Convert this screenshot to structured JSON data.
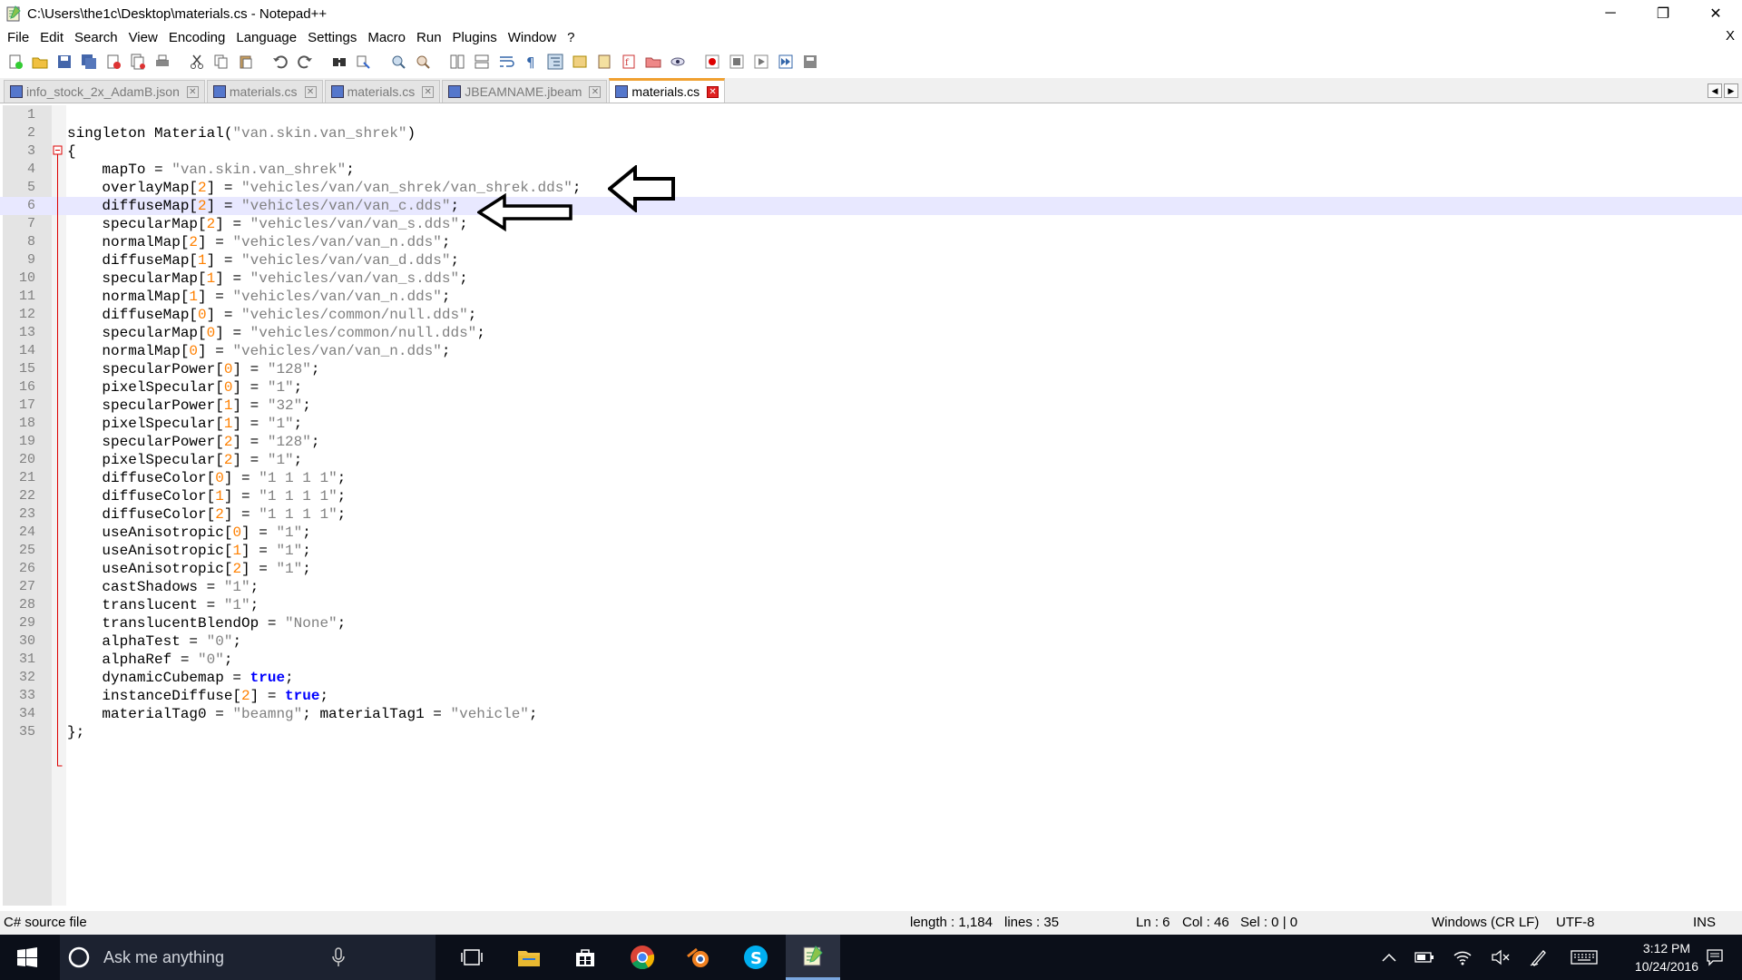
{
  "window": {
    "title": "C:\\Users\\the1c\\Desktop\\materials.cs - Notepad++",
    "close_doc": "X"
  },
  "menu": [
    "File",
    "Edit",
    "Search",
    "View",
    "Encoding",
    "Language",
    "Settings",
    "Macro",
    "Run",
    "Plugins",
    "Window",
    "?"
  ],
  "tabs": [
    {
      "label": "info_stock_2x_AdamB.json",
      "active": false
    },
    {
      "label": "materials.cs",
      "active": false
    },
    {
      "label": "materials.cs",
      "active": false
    },
    {
      "label": "JBEAMNAME.jbeam",
      "active": false
    },
    {
      "label": "materials.cs",
      "active": true
    }
  ],
  "editor": {
    "current_line": 6,
    "lines": [
      {
        "n": "1",
        "segs": []
      },
      {
        "n": "2",
        "segs": [
          [
            "t",
            "singleton Material("
          ],
          [
            "s",
            "\"van.skin.van_shrek\""
          ],
          [
            "t",
            ")"
          ]
        ]
      },
      {
        "n": "3",
        "segs": [
          [
            "t",
            "{"
          ]
        ]
      },
      {
        "n": "4",
        "segs": [
          [
            "t",
            "    mapTo = "
          ],
          [
            "s",
            "\"van.skin.van_shrek\""
          ],
          [
            "t",
            ";"
          ]
        ]
      },
      {
        "n": "5",
        "segs": [
          [
            "t",
            "    overlayMap["
          ],
          [
            "n",
            "2"
          ],
          [
            "t",
            "] = "
          ],
          [
            "s",
            "\"vehicles/van/van_shrek/van_shrek.dds\""
          ],
          [
            "t",
            ";"
          ]
        ]
      },
      {
        "n": "6",
        "segs": [
          [
            "t",
            "    diffuseMap["
          ],
          [
            "n",
            "2"
          ],
          [
            "t",
            "] = "
          ],
          [
            "s",
            "\"vehicles/van/van_c.dds\""
          ],
          [
            "t",
            ";"
          ]
        ]
      },
      {
        "n": "7",
        "segs": [
          [
            "t",
            "    specularMap["
          ],
          [
            "n",
            "2"
          ],
          [
            "t",
            "] = "
          ],
          [
            "s",
            "\"vehicles/van/van_s.dds\""
          ],
          [
            "t",
            ";"
          ]
        ]
      },
      {
        "n": "8",
        "segs": [
          [
            "t",
            "    normalMap["
          ],
          [
            "n",
            "2"
          ],
          [
            "t",
            "] = "
          ],
          [
            "s",
            "\"vehicles/van/van_n.dds\""
          ],
          [
            "t",
            ";"
          ]
        ]
      },
      {
        "n": "9",
        "segs": [
          [
            "t",
            "    diffuseMap["
          ],
          [
            "n",
            "1"
          ],
          [
            "t",
            "] = "
          ],
          [
            "s",
            "\"vehicles/van/van_d.dds\""
          ],
          [
            "t",
            ";"
          ]
        ]
      },
      {
        "n": "10",
        "segs": [
          [
            "t",
            "    specularMap["
          ],
          [
            "n",
            "1"
          ],
          [
            "t",
            "] = "
          ],
          [
            "s",
            "\"vehicles/van/van_s.dds\""
          ],
          [
            "t",
            ";"
          ]
        ]
      },
      {
        "n": "11",
        "segs": [
          [
            "t",
            "    normalMap["
          ],
          [
            "n",
            "1"
          ],
          [
            "t",
            "] = "
          ],
          [
            "s",
            "\"vehicles/van/van_n.dds\""
          ],
          [
            "t",
            ";"
          ]
        ]
      },
      {
        "n": "12",
        "segs": [
          [
            "t",
            "    diffuseMap["
          ],
          [
            "n",
            "0"
          ],
          [
            "t",
            "] = "
          ],
          [
            "s",
            "\"vehicles/common/null.dds\""
          ],
          [
            "t",
            ";"
          ]
        ]
      },
      {
        "n": "13",
        "segs": [
          [
            "t",
            "    specularMap["
          ],
          [
            "n",
            "0"
          ],
          [
            "t",
            "] = "
          ],
          [
            "s",
            "\"vehicles/common/null.dds\""
          ],
          [
            "t",
            ";"
          ]
        ]
      },
      {
        "n": "14",
        "segs": [
          [
            "t",
            "    normalMap["
          ],
          [
            "n",
            "0"
          ],
          [
            "t",
            "] = "
          ],
          [
            "s",
            "\"vehicles/van/van_n.dds\""
          ],
          [
            "t",
            ";"
          ]
        ]
      },
      {
        "n": "15",
        "segs": [
          [
            "t",
            "    specularPower["
          ],
          [
            "n",
            "0"
          ],
          [
            "t",
            "] = "
          ],
          [
            "s",
            "\"128\""
          ],
          [
            "t",
            ";"
          ]
        ]
      },
      {
        "n": "16",
        "segs": [
          [
            "t",
            "    pixelSpecular["
          ],
          [
            "n",
            "0"
          ],
          [
            "t",
            "] = "
          ],
          [
            "s",
            "\"1\""
          ],
          [
            "t",
            ";"
          ]
        ]
      },
      {
        "n": "17",
        "segs": [
          [
            "t",
            "    specularPower["
          ],
          [
            "n",
            "1"
          ],
          [
            "t",
            "] = "
          ],
          [
            "s",
            "\"32\""
          ],
          [
            "t",
            ";"
          ]
        ]
      },
      {
        "n": "18",
        "segs": [
          [
            "t",
            "    pixelSpecular["
          ],
          [
            "n",
            "1"
          ],
          [
            "t",
            "] = "
          ],
          [
            "s",
            "\"1\""
          ],
          [
            "t",
            ";"
          ]
        ]
      },
      {
        "n": "19",
        "segs": [
          [
            "t",
            "    specularPower["
          ],
          [
            "n",
            "2"
          ],
          [
            "t",
            "] = "
          ],
          [
            "s",
            "\"128\""
          ],
          [
            "t",
            ";"
          ]
        ]
      },
      {
        "n": "20",
        "segs": [
          [
            "t",
            "    pixelSpecular["
          ],
          [
            "n",
            "2"
          ],
          [
            "t",
            "] = "
          ],
          [
            "s",
            "\"1\""
          ],
          [
            "t",
            ";"
          ]
        ]
      },
      {
        "n": "21",
        "segs": [
          [
            "t",
            "    diffuseColor["
          ],
          [
            "n",
            "0"
          ],
          [
            "t",
            "] = "
          ],
          [
            "s",
            "\"1 1 1 1\""
          ],
          [
            "t",
            ";"
          ]
        ]
      },
      {
        "n": "22",
        "segs": [
          [
            "t",
            "    diffuseColor["
          ],
          [
            "n",
            "1"
          ],
          [
            "t",
            "] = "
          ],
          [
            "s",
            "\"1 1 1 1\""
          ],
          [
            "t",
            ";"
          ]
        ]
      },
      {
        "n": "23",
        "segs": [
          [
            "t",
            "    diffuseColor["
          ],
          [
            "n",
            "2"
          ],
          [
            "t",
            "] = "
          ],
          [
            "s",
            "\"1 1 1 1\""
          ],
          [
            "t",
            ";"
          ]
        ]
      },
      {
        "n": "24",
        "segs": [
          [
            "t",
            "    useAnisotropic["
          ],
          [
            "n",
            "0"
          ],
          [
            "t",
            "] = "
          ],
          [
            "s",
            "\"1\""
          ],
          [
            "t",
            ";"
          ]
        ]
      },
      {
        "n": "25",
        "segs": [
          [
            "t",
            "    useAnisotropic["
          ],
          [
            "n",
            "1"
          ],
          [
            "t",
            "] = "
          ],
          [
            "s",
            "\"1\""
          ],
          [
            "t",
            ";"
          ]
        ]
      },
      {
        "n": "26",
        "segs": [
          [
            "t",
            "    useAnisotropic["
          ],
          [
            "n",
            "2"
          ],
          [
            "t",
            "] = "
          ],
          [
            "s",
            "\"1\""
          ],
          [
            "t",
            ";"
          ]
        ]
      },
      {
        "n": "27",
        "segs": [
          [
            "t",
            "    castShadows = "
          ],
          [
            "s",
            "\"1\""
          ],
          [
            "t",
            ";"
          ]
        ]
      },
      {
        "n": "28",
        "segs": [
          [
            "t",
            "    translucent = "
          ],
          [
            "s",
            "\"1\""
          ],
          [
            "t",
            ";"
          ]
        ]
      },
      {
        "n": "29",
        "segs": [
          [
            "t",
            "    translucentBlendOp = "
          ],
          [
            "s",
            "\"None\""
          ],
          [
            "t",
            ";"
          ]
        ]
      },
      {
        "n": "30",
        "segs": [
          [
            "t",
            "    alphaTest = "
          ],
          [
            "s",
            "\"0\""
          ],
          [
            "t",
            ";"
          ]
        ]
      },
      {
        "n": "31",
        "segs": [
          [
            "t",
            "    alphaRef = "
          ],
          [
            "s",
            "\"0\""
          ],
          [
            "t",
            ";"
          ]
        ]
      },
      {
        "n": "32",
        "segs": [
          [
            "t",
            "    dynamicCubemap = "
          ],
          [
            "k",
            "true"
          ],
          [
            "t",
            ";"
          ]
        ]
      },
      {
        "n": "33",
        "segs": [
          [
            "t",
            "    instanceDiffuse["
          ],
          [
            "n",
            "2"
          ],
          [
            "t",
            "] = "
          ],
          [
            "k",
            "true"
          ],
          [
            "t",
            ";"
          ]
        ]
      },
      {
        "n": "34",
        "segs": [
          [
            "t",
            "    materialTag0 = "
          ],
          [
            "s",
            "\"beamng\""
          ],
          [
            "t",
            "; materialTag1 = "
          ],
          [
            "s",
            "\"vehicle\""
          ],
          [
            "t",
            ";"
          ]
        ]
      },
      {
        "n": "35",
        "segs": [
          [
            "t",
            "};"
          ]
        ]
      }
    ]
  },
  "status": {
    "file_type": "C# source file",
    "length": "length : 1,184",
    "lines": "lines : 35",
    "ln": "Ln : 6",
    "col": "Col : 46",
    "sel": "Sel : 0 | 0",
    "eol": "Windows (CR LF)",
    "encoding": "UTF-8",
    "mode": "INS"
  },
  "taskbar": {
    "search_placeholder": "Ask me anything",
    "time": "3:12 PM",
    "date": "10/24/2016"
  },
  "colors": {
    "string": "#808080",
    "number": "#ff8000",
    "keyword": "#0000ff",
    "active_tab_accent": "#f0a030",
    "current_line": "#e8e8ff",
    "taskbar": "#0b0f19"
  }
}
